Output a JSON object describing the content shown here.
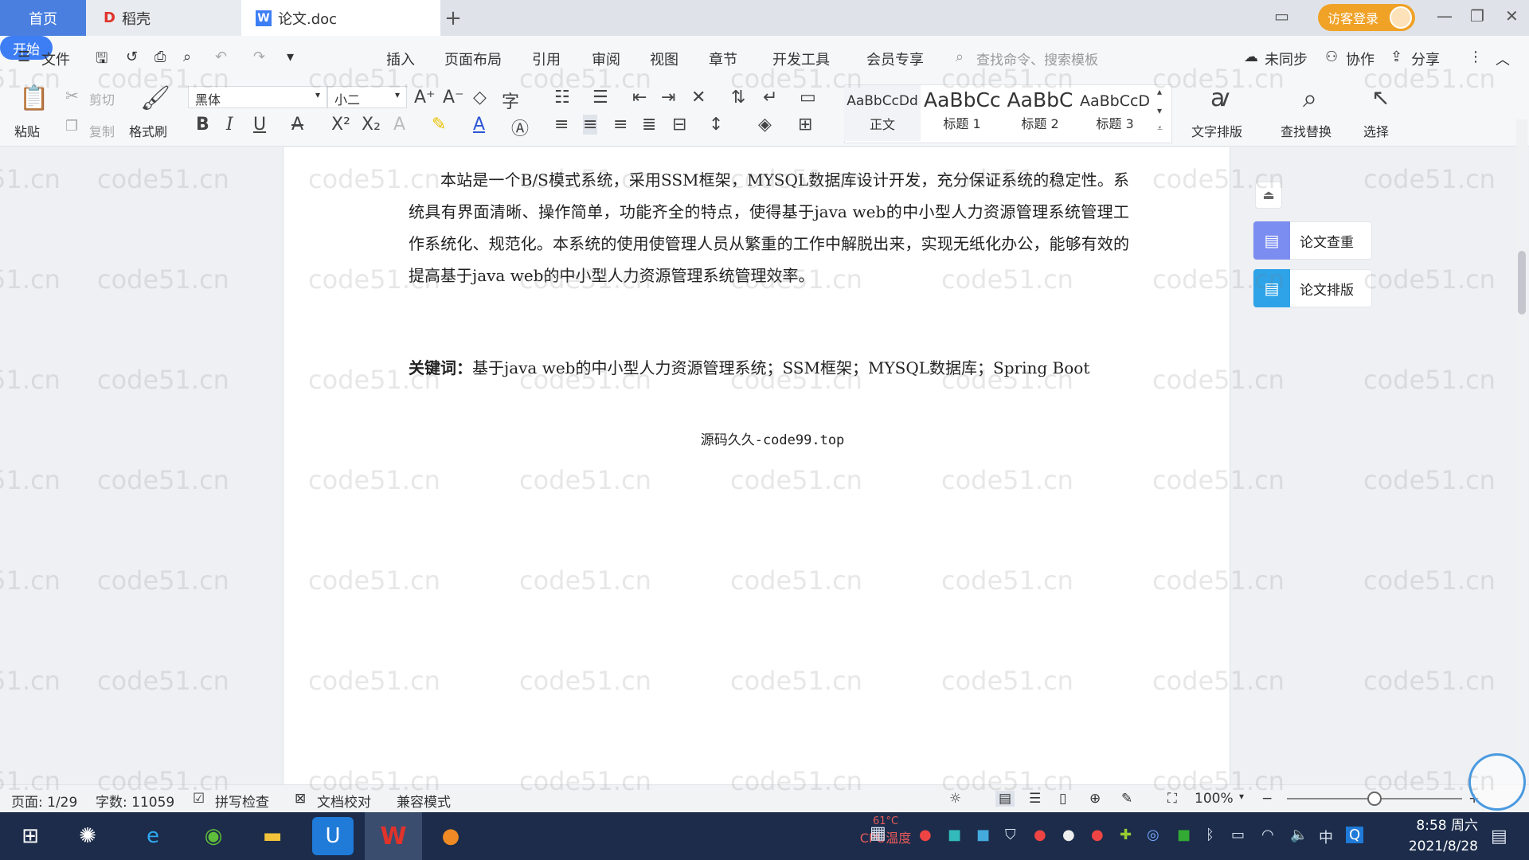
{
  "titlebar": {
    "tabs": [
      {
        "label": "首页"
      },
      {
        "label": "稻壳"
      },
      {
        "label": "论文.doc"
      }
    ],
    "login_label": "访客登录"
  },
  "menubar": {
    "file_label": "文件",
    "items": [
      "开始",
      "插入",
      "页面布局",
      "引用",
      "审阅",
      "视图",
      "章节",
      "开发工具",
      "会员专享"
    ],
    "search_placeholder": "查找命令、搜索模板",
    "sync_label": "未同步",
    "collab_label": "协作",
    "share_label": "分享"
  },
  "ribbon": {
    "paste_label": "粘贴",
    "cut_label": "剪切",
    "copy_label": "复制",
    "format_painter_label": "格式刷",
    "font_name": "黑体",
    "font_size": "小二",
    "styles": [
      {
        "sample": "AaBbCcDd",
        "name": "正文"
      },
      {
        "sample": "AaBbCc",
        "name": "标题 1"
      },
      {
        "sample": "AaBbC",
        "name": "标题 2"
      },
      {
        "sample": "AaBbCcD",
        "name": "标题 3"
      }
    ],
    "text_layout_label": "文字排版",
    "find_replace_label": "查找替换",
    "select_label": "选择"
  },
  "document": {
    "paragraph": "本站是一个B/S模式系统，采用SSM框架，MYSQL数据库设计开发，充分保证系统的稳定性。系统具有界面清晰、操作简单，功能齐全的特点，使得基于java web的中小型人力资源管理系统管理工作系统化、规范化。本系统的使用使管理人员从繁重的工作中解脱出来，实现无纸化办公，能够有效的提高基于java web的中小型人力资源管理系统管理效率。",
    "keywords_label": "关键词：",
    "keywords": "基于java web的中小型人力资源管理系统；SSM框架；MYSQL数据库；Spring Boot",
    "footer_note": "源码久久-code99.top"
  },
  "side_panel": {
    "check_label": "论文查重",
    "layout_label": "论文排版"
  },
  "statusbar": {
    "page": "页面: 1/29",
    "words": "字数: 11059",
    "spell_check": "拼写检查",
    "proofread": "文档校对",
    "compat_mode": "兼容模式",
    "zoom": "100%",
    "zoom_level": 0.5
  },
  "taskbar": {
    "time": "8:58 周六",
    "date": "2021/8/28",
    "cpu_temp": "61°C",
    "cpu_label": "CPU温度",
    "ime": "中"
  },
  "watermark": "code51.cn",
  "colors": {
    "accent": "#3d7ef5",
    "login": "#f0a227",
    "taskbar": "#1c2c4a",
    "home_tab": "#4a7fe0"
  }
}
